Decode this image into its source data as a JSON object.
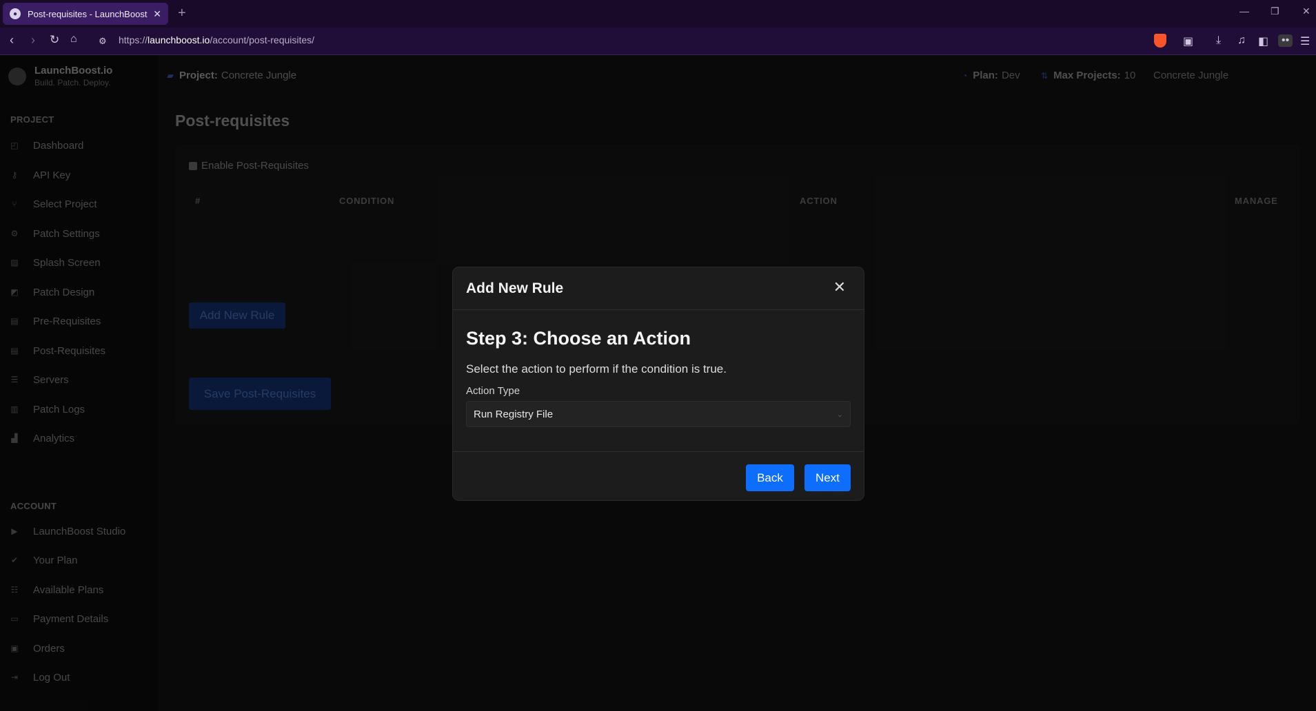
{
  "browser": {
    "tab_title": "Post-requisites - LaunchBoost",
    "url_prefix": "https://",
    "url_domain": "launchboost.io",
    "url_path": "/account/post-requisites/"
  },
  "brand": {
    "name": "LaunchBoost.io",
    "tagline": "Build. Patch. Deploy."
  },
  "sidebar": {
    "project_title": "PROJECT",
    "project_items": [
      {
        "label": "Dashboard",
        "icon": "dashboard-icon"
      },
      {
        "label": "API Key",
        "icon": "key-icon"
      },
      {
        "label": "Select Project",
        "icon": "project-tree-icon"
      },
      {
        "label": "Patch Settings",
        "icon": "gear-icon"
      },
      {
        "label": "Splash Screen",
        "icon": "image-icon"
      },
      {
        "label": "Patch Design",
        "icon": "design-icon"
      },
      {
        "label": "Pre-Requisites",
        "icon": "list-icon"
      },
      {
        "label": "Post-Requisites",
        "icon": "list-icon"
      },
      {
        "label": "Servers",
        "icon": "server-icon"
      },
      {
        "label": "Patch Logs",
        "icon": "log-icon"
      },
      {
        "label": "Analytics",
        "icon": "chart-icon"
      }
    ],
    "account_title": "ACCOUNT",
    "account_items": [
      {
        "label": "LaunchBoost Studio",
        "icon": "play-icon"
      },
      {
        "label": "Your Plan",
        "icon": "check-icon"
      },
      {
        "label": "Available Plans",
        "icon": "list-icon"
      },
      {
        "label": "Payment Details",
        "icon": "card-icon"
      },
      {
        "label": "Orders",
        "icon": "orders-icon"
      },
      {
        "label": "Log Out",
        "icon": "logout-icon"
      }
    ]
  },
  "topbar": {
    "project_label": "Project:",
    "project_value": "Concrete Jungle",
    "plan_label": "Plan:",
    "plan_value": "Dev",
    "max_label": "Max Projects:",
    "max_value": "10",
    "current_project": "Concrete Jungle"
  },
  "page": {
    "title": "Post-requisites",
    "enable_label": "Enable Post-Requisites",
    "columns": [
      "#",
      "CONDITION",
      "ACTION",
      "MANAGE"
    ],
    "add_rule_button": "Add New Rule",
    "save_button": "Save Post-Requisites"
  },
  "modal": {
    "title": "Add New Rule",
    "close": "✕",
    "step_title": "Step 3: Choose an Action",
    "description": "Select the action to perform if the condition is true.",
    "field_label": "Action Type",
    "selected_value": "Run Registry File",
    "back_button": "Back",
    "next_button": "Next"
  }
}
